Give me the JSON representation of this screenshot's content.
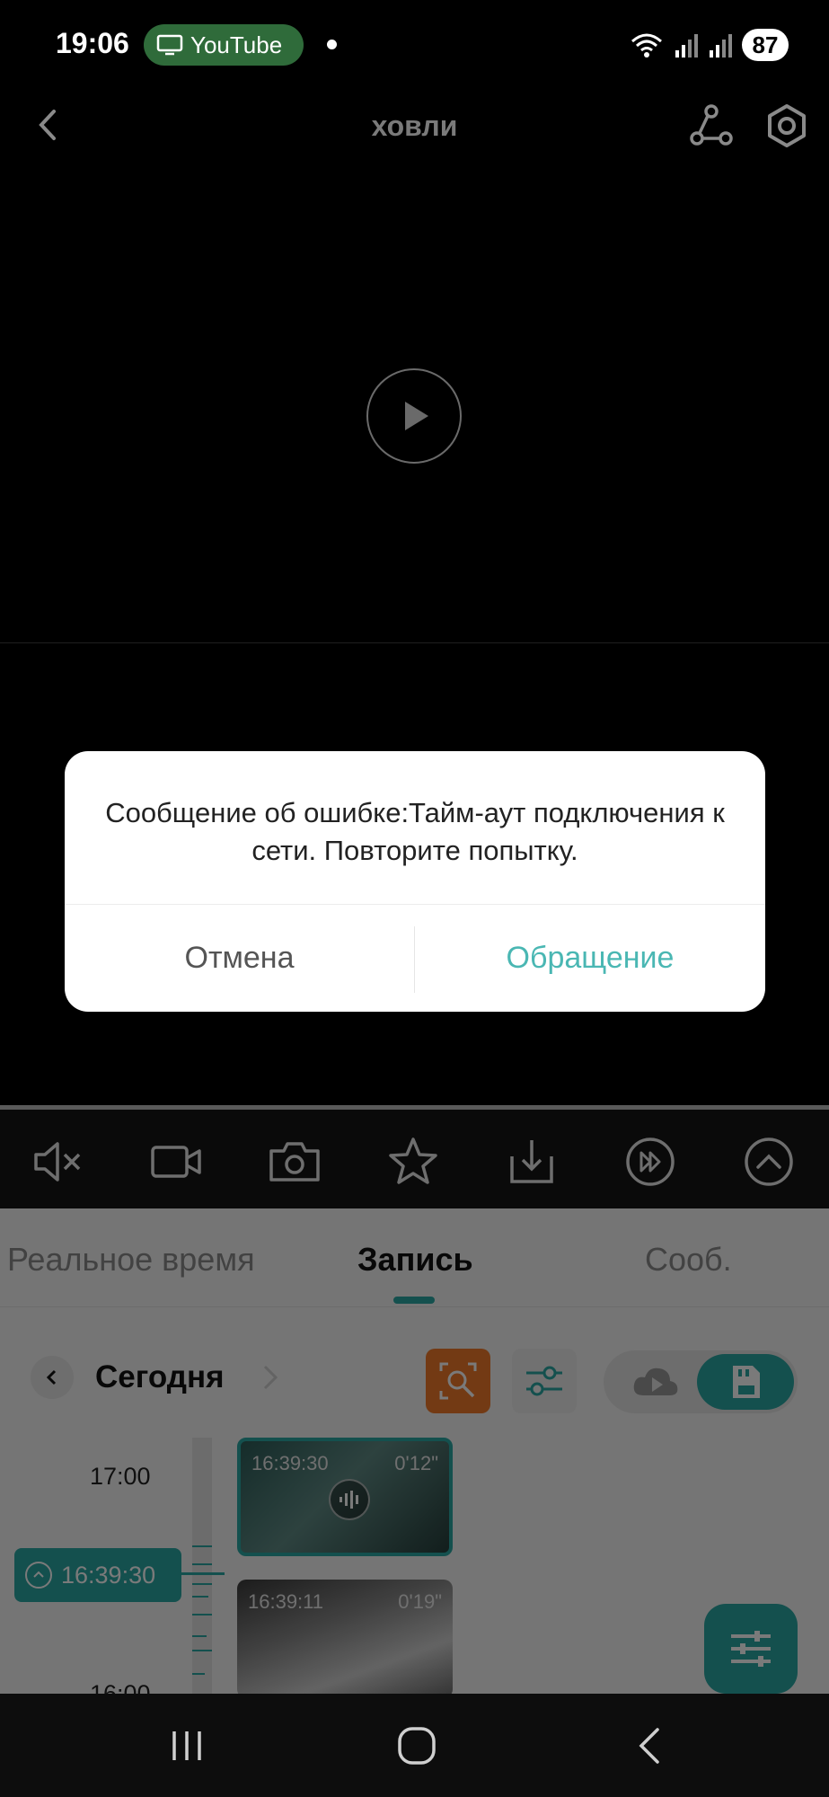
{
  "status_bar": {
    "time": "19:06",
    "notification_app": "YouTube",
    "battery": "87"
  },
  "header": {
    "title": "ховли",
    "back_icon": "chevron-left-icon",
    "share_icon": "share-icon",
    "settings_icon": "hexagon-settings-icon"
  },
  "video": {
    "play_icon": "play-icon"
  },
  "controls": [
    {
      "name": "mute-button",
      "icon": "speaker-muted-icon"
    },
    {
      "name": "record-button",
      "icon": "video-camera-icon"
    },
    {
      "name": "snapshot-button",
      "icon": "camera-icon"
    },
    {
      "name": "favorite-button",
      "icon": "star-icon"
    },
    {
      "name": "download-button",
      "icon": "download-icon"
    },
    {
      "name": "fast-forward-button",
      "icon": "fast-forward-icon"
    },
    {
      "name": "collapse-button",
      "icon": "chevron-up-icon"
    }
  ],
  "tabs": {
    "live": "Реальное время",
    "record": "Запись",
    "messages": "Сооб."
  },
  "date_nav": {
    "label": "Сегодня"
  },
  "timeline": {
    "hours": [
      "17:00",
      "16:00"
    ],
    "current_marker": "16:39:30"
  },
  "clips": [
    {
      "start": "16:39:30",
      "duration": "0'12\""
    },
    {
      "start": "16:39:11",
      "duration": "0'19\""
    }
  ],
  "dialog": {
    "message": "Сообщение об ошибке:Тайм-аут подключения к сети. Повторите попытку.",
    "cancel_label": "Отмена",
    "contact_label": "Обращение"
  },
  "colors": {
    "accent": "#2aa7a3",
    "search_button": "#f07a2a",
    "dialog_link": "#4ab7b3",
    "notification_pill": "#2f6b3a"
  }
}
